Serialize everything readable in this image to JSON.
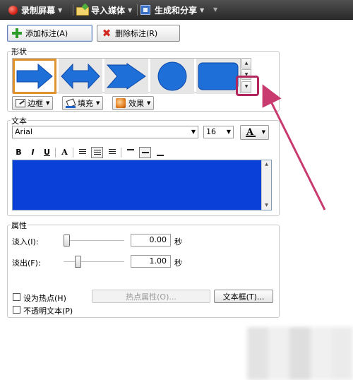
{
  "toolbar": {
    "record_screen": "录制屏幕",
    "import_media": "导入媒体",
    "produce_share": "生成和分享"
  },
  "actions": {
    "add_callout": "添加标注(A)",
    "delete_callout": "删除标注(R)"
  },
  "shape_section": {
    "label": "形状",
    "shapes": [
      "arrow-right",
      "arrow-double",
      "arrow-chevron-right",
      "circle",
      "rounded-rectangle"
    ],
    "selected_index": 0,
    "border_button": "边框",
    "fill_button": "填充",
    "effects_button": "效果"
  },
  "text_section": {
    "label": "文本",
    "font_name": "Arial",
    "font_size": "16",
    "font_color_glyph": "A",
    "format_buttons": {
      "bold": "B",
      "italic": "I",
      "underline": "U",
      "shadow": "A"
    },
    "text_background_color": "#0a3fd8"
  },
  "properties_section": {
    "label": "属性",
    "fade_in_label": "淡入(I):",
    "fade_in_value": "0.00",
    "fade_in_level": 0.0,
    "fade_out_label": "淡出(F):",
    "fade_out_value": "1.00",
    "fade_out_level": 0.2,
    "unit": "秒",
    "hotspot_checkbox_label": "设为热点(H)",
    "hotspot_properties_button": "热点属性(O)...",
    "textbox_button": "文本框(T)...",
    "opaque_text_checkbox_label": "不透明文本(P)"
  },
  "colors": {
    "accent_orange": "#e0922f",
    "shape_blue": "#1f6fd9",
    "annotation_pink": "#c93b6f"
  }
}
